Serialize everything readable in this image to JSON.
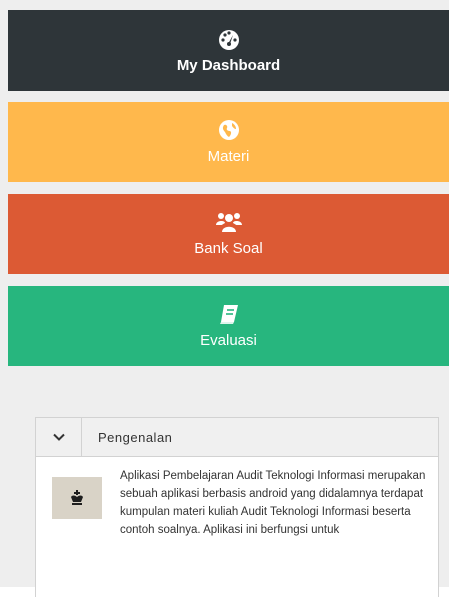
{
  "menu": {
    "dashboard": {
      "label": "My Dashboard",
      "icon": "dashboard-gauge-icon",
      "color": "#2e3539"
    },
    "materi": {
      "label": "Materi",
      "icon": "globe-icon",
      "color": "#ffb84c"
    },
    "bank_soal": {
      "label": "Bank Soal",
      "icon": "users-group-icon",
      "color": "#dc5a34"
    },
    "evaluasi": {
      "label": "Evaluasi",
      "icon": "book-icon",
      "color": "#27b67e"
    }
  },
  "panel": {
    "title": "Pengenalan",
    "toggle_icon": "chevron-down-icon",
    "thumbnail_icon": "chess-king-icon",
    "body": "Aplikasi Pembelajaran Audit Teknologi Informasi merupakan sebuah aplikasi berbasis android yang didalamnya terdapat kumpulan materi kuliah Audit Teknologi Informasi beserta contoh soalnya. Aplikasi ini berfungsi untuk"
  }
}
